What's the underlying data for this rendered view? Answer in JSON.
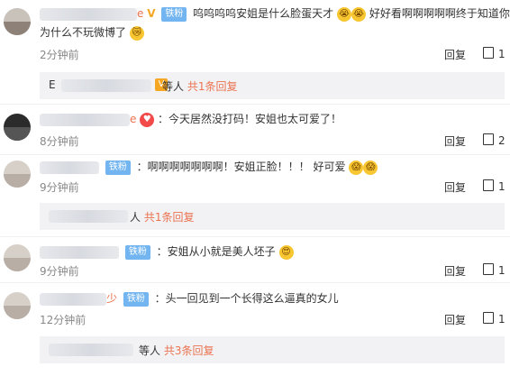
{
  "comments": [
    {
      "name_tail": "e",
      "vip": "V",
      "badge": "铁粉",
      "text1": "呜呜呜呜安姐是什么脸蛋天才",
      "text2": "好好看啊啊啊啊啊终于知道你",
      "text3": "为什么不玩微博了",
      "time": "2分钟前",
      "reply": "回复",
      "likes": "1",
      "sub": {
        "tail": "等人",
        "link": "共1条回复"
      }
    },
    {
      "name_tail": "e",
      "badge": "",
      "text1": "：今天居然没打码！安姐也太可爱了！",
      "time": "8分钟前",
      "reply": "回复",
      "likes": "2"
    },
    {
      "badge": "铁粉",
      "text1": "：啊啊啊啊啊啊啊！安姐正脸！！！ 好可爱",
      "time": "9分钟前",
      "reply": "回复",
      "likes": "1",
      "sub": {
        "tail": "人",
        "link": "共1条回复"
      }
    },
    {
      "badge": "铁粉",
      "text1": "：安姐从小就是美人坯子",
      "time": "9分钟前",
      "reply": "回复",
      "likes": "1"
    },
    {
      "name_tail": "少",
      "badge": "铁粉",
      "text1": "：头一回见到一个长得这么逼真的女儿",
      "time": "12分钟前",
      "reply": "回复",
      "likes": "1",
      "sub": {
        "tail": "等人",
        "link": "共3条回复"
      }
    }
  ],
  "first_sub_prefix": "E"
}
